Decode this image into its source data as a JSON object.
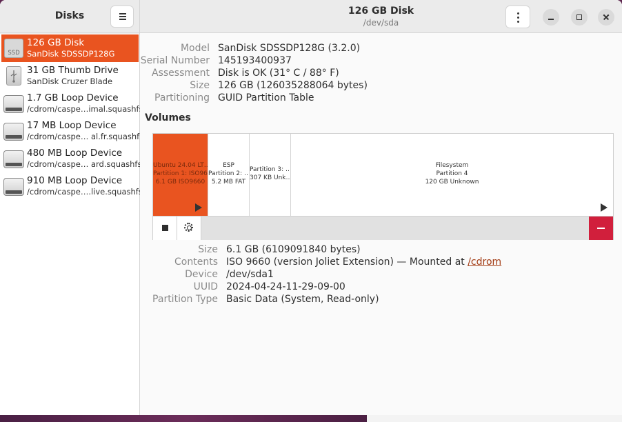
{
  "sidebar": {
    "title": "Disks",
    "items": [
      {
        "name": "126 GB Disk",
        "sub": "SanDisk SDSSDP128G",
        "icon": "ssd-icon",
        "icon_label": "SSD",
        "selected": true
      },
      {
        "name": "31 GB Thumb Drive",
        "sub": "SanDisk Cruzer Blade",
        "icon": "usb-drive-icon"
      },
      {
        "name": "1.7 GB Loop Device",
        "sub": "/cdrom/caspe…imal.squashfs",
        "icon": "loop-device-icon"
      },
      {
        "name": "17 MB Loop Device",
        "sub": "/cdrom/caspe… al.fr.squashfs",
        "icon": "loop-device-icon"
      },
      {
        "name": "480 MB Loop Device",
        "sub": "/cdrom/caspe…  ard.squashfs",
        "icon": "loop-device-icon"
      },
      {
        "name": "910 MB Loop Device",
        "sub": "/cdrom/caspe….live.squashfs",
        "icon": "loop-device-icon"
      }
    ]
  },
  "header": {
    "title": "126 GB Disk",
    "subtitle": "/dev/sda"
  },
  "disk_info": [
    {
      "key": "Model",
      "value": "SanDisk SDSSDP128G (3.2.0)"
    },
    {
      "key": "Serial Number",
      "value": "145193400937"
    },
    {
      "key": "Assessment",
      "value": "Disk is OK (31° C / 88° F)"
    },
    {
      "key": "Size",
      "value": "126 GB (126035288064 bytes)"
    },
    {
      "key": "Partitioning",
      "value": "GUID Partition Table"
    }
  ],
  "volumes": {
    "title": "Volumes",
    "partitions": [
      {
        "line1": "Ubuntu 24.04 LT…",
        "line2": "Partition 1: ISO96…",
        "line3": "6.1 GB ISO9660",
        "selected": true,
        "mounted": true
      },
      {
        "line1": "ESP",
        "line2": "Partition 2: …",
        "line3": "5.2 MB FAT"
      },
      {
        "line1": "Partition 3: …",
        "line2": "307 KB Unk…"
      },
      {
        "line1": "Filesystem",
        "line2": "Partition 4",
        "line3": "120 GB Unknown",
        "mountable": true
      }
    ]
  },
  "volume_info": {
    "size": {
      "key": "Size",
      "value": "6.1 GB (6109091840 bytes)"
    },
    "contents": {
      "key": "Contents",
      "value_prefix": "ISO 9660 (version Joliet Extension) — Mounted at ",
      "link": "/cdrom"
    },
    "device": {
      "key": "Device",
      "value": "/dev/sda1"
    },
    "uuid": {
      "key": "UUID",
      "value": "2024-04-24-11-29-09-00"
    },
    "partition_type": {
      "key": "Partition Type",
      "value": "Basic Data (System, Read-only)"
    }
  },
  "colors": {
    "accent": "#e95420",
    "danger": "#d11f3c"
  }
}
